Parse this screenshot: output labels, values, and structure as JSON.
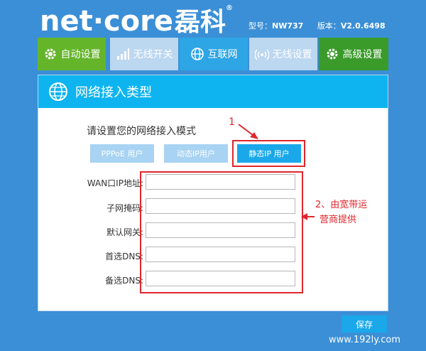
{
  "brand": {
    "name": "net",
    "dot": "·",
    "name2": "core",
    "cn": "磊科",
    "reg": "®"
  },
  "device": {
    "model_label": "型号：",
    "model": "NW737",
    "version_label": "版本：",
    "version": "V2.0.6498"
  },
  "nav": [
    {
      "label": "自动设置",
      "icon": "gear-icon"
    },
    {
      "label": "无线开关",
      "icon": "signal-bars-icon"
    },
    {
      "label": "互联网",
      "icon": "globe-icon"
    },
    {
      "label": "无线设置",
      "icon": "wireless-icon"
    },
    {
      "label": "高级设置",
      "icon": "gear-icon"
    }
  ],
  "panel": {
    "title": "网络接入类型",
    "subtitle": "请设置您的网络接入模式",
    "modes": [
      "PPPoE 用户",
      "动态IP用户",
      "静态IP 用户"
    ],
    "selected_mode": "静态IP 用户",
    "fields": [
      {
        "label": "WAN口IP地址:",
        "value": ""
      },
      {
        "label": "子网掩码:",
        "value": ""
      },
      {
        "label": "默认网关:",
        "value": ""
      },
      {
        "label": "首选DNS:",
        "value": ""
      },
      {
        "label": "备选DNS:",
        "value": ""
      }
    ],
    "save_label": "保存"
  },
  "annotations": {
    "step1": "1",
    "step2_line1": "2、由宽带运",
    "step2_line2": "营商提供"
  },
  "watermark": "www.192ly.com",
  "colors": {
    "background": "#3b8fd6",
    "accent_blue": "#1aa8ea",
    "green": "#65b52b",
    "annotation_red": "#e0262b"
  }
}
